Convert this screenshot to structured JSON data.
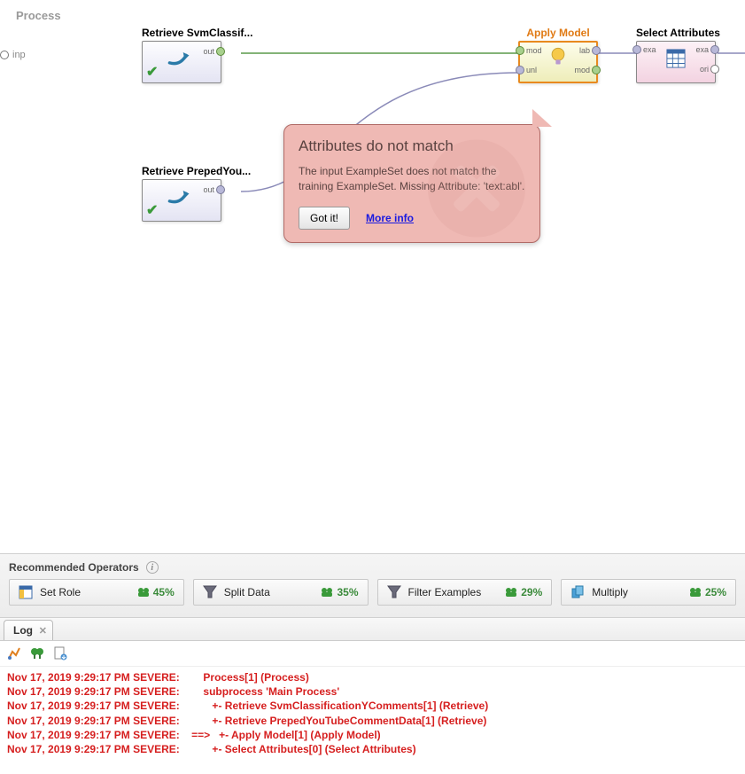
{
  "canvas": {
    "title": "Process",
    "input_port": "inp"
  },
  "operators": {
    "retrieve1": {
      "title": "Retrieve SvmClassif...",
      "port_out": "out"
    },
    "retrieve2": {
      "title": "Retrieve PrepedYou...",
      "port_out": "out"
    },
    "apply": {
      "title": "Apply Model",
      "port_mod_in": "mod",
      "port_unl_in": "unl",
      "port_lab_out": "lab",
      "port_mod_out": "mod"
    },
    "select": {
      "title": "Select Attributes",
      "port_exa_in": "exa",
      "port_exa_out": "exa",
      "port_ori_out": "ori"
    }
  },
  "error": {
    "title": "Attributes do not match",
    "message": "The input ExampleSet does not match the training ExampleSet. Missing Attribute: 'text:abl'.",
    "gotit": "Got it!",
    "more": "More info"
  },
  "recommended": {
    "header": "Recommended Operators",
    "items": [
      {
        "label": "Set Role",
        "pct": "45%",
        "icon": "setrole"
      },
      {
        "label": "Split Data",
        "pct": "35%",
        "icon": "filter"
      },
      {
        "label": "Filter Examples",
        "pct": "29%",
        "icon": "filter"
      },
      {
        "label": "Multiply",
        "pct": "25%",
        "icon": "multiply"
      }
    ]
  },
  "log": {
    "tab": "Log",
    "entries": [
      "Nov 17, 2019 9:29:17 PM SEVERE:        Process[1] (Process)",
      "Nov 17, 2019 9:29:17 PM SEVERE:        subprocess 'Main Process'",
      "Nov 17, 2019 9:29:17 PM SEVERE:           +- Retrieve SvmClassificationYComments[1] (Retrieve)",
      "Nov 17, 2019 9:29:17 PM SEVERE:           +- Retrieve PrepedYouTubeCommentData[1] (Retrieve)",
      "Nov 17, 2019 9:29:17 PM SEVERE:    ==>   +- Apply Model[1] (Apply Model)",
      "Nov 17, 2019 9:29:17 PM SEVERE:           +- Select Attributes[0] (Select Attributes)"
    ]
  }
}
